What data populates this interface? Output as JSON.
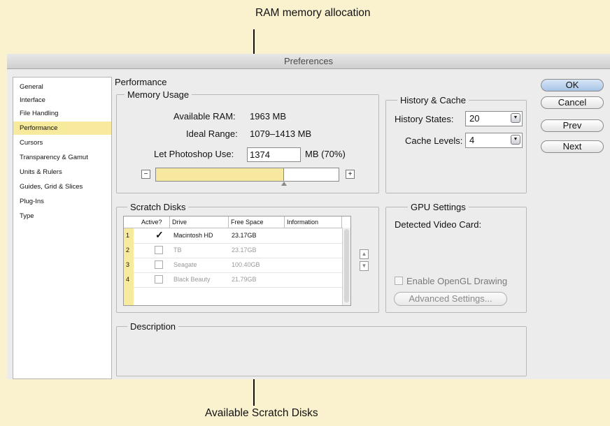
{
  "callouts": {
    "top": "RAM memory allocation",
    "bottom": "Available Scratch Disks"
  },
  "window": {
    "title": "Preferences"
  },
  "sidebar": {
    "items": [
      {
        "label": "General"
      },
      {
        "label": "Interface"
      },
      {
        "label": "File Handling"
      },
      {
        "label": "Performance",
        "selected": true
      },
      {
        "label": "Cursors"
      },
      {
        "label": "Transparency & Gamut"
      },
      {
        "label": "Units & Rulers"
      },
      {
        "label": "Guides, Grid & Slices"
      },
      {
        "label": "Plug-Ins"
      },
      {
        "label": "Type"
      }
    ]
  },
  "main": {
    "title": "Performance",
    "memory": {
      "heading": "Memory Usage",
      "available_label": "Available RAM:",
      "available_value": "1963 MB",
      "ideal_label": "Ideal Range:",
      "ideal_value": "1079–1413 MB",
      "use_label": "Let Photoshop Use:",
      "use_value": "1374",
      "use_suffix": "MB (70%)",
      "slider_fraction": 0.7,
      "minus": "−",
      "plus": "+"
    },
    "history": {
      "heading": "History & Cache",
      "states_label": "History States:",
      "states_value": "20",
      "levels_label": "Cache Levels:",
      "levels_value": "4",
      "arrow": "▼"
    },
    "scratch": {
      "heading": "Scratch Disks",
      "columns": [
        "Active?",
        "Drive",
        "Free Space",
        "Information"
      ],
      "rows": [
        {
          "num": "1",
          "checked": true,
          "drive": "Macintosh HD",
          "free": "23.17GB"
        },
        {
          "num": "2",
          "checked": false,
          "drive": "TB",
          "free": "23.17GB"
        },
        {
          "num": "3",
          "checked": false,
          "drive": "Seagate",
          "free": "100.40GB"
        },
        {
          "num": "4",
          "checked": false,
          "drive": "Black Beauty",
          "free": "21.79GB"
        }
      ],
      "checkmark": "✓",
      "move_up": "▲",
      "move_down": "▼"
    },
    "gpu": {
      "heading": "GPU Settings",
      "detected_label": "Detected Video Card:",
      "opengl_label": "Enable OpenGL Drawing",
      "advanced_label": "Advanced Settings..."
    },
    "description": {
      "heading": "Description"
    }
  },
  "buttons": {
    "ok": "OK",
    "cancel": "Cancel",
    "prev": "Prev",
    "next": "Next"
  }
}
